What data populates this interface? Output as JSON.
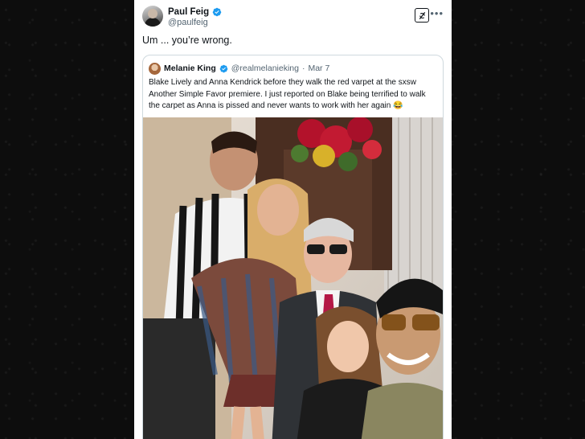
{
  "tweet": {
    "author": {
      "name": "Paul Feig",
      "handle": "@paulfeig"
    },
    "text": "Um ... you’re wrong."
  },
  "quoted": {
    "author": {
      "name": "Melanie King",
      "handle": "@realmelanieking"
    },
    "separator": "·",
    "date": "Mar 7",
    "text": "Blake Lively and Anna Kendrick before they walk the red varpet at the sxsw Another Simple Favor premiere. I just reported on Blake being terrified to walk the carpet as Anna is pissed and never wants to work with her again 😂"
  },
  "icons": {
    "verified": "verified-badge-icon",
    "grok": "grok-icon",
    "more": "more-icon"
  },
  "colors": {
    "verified": "#1d9bf0",
    "text": "#0f1419",
    "muted": "#536471",
    "border": "#cfd9de"
  }
}
